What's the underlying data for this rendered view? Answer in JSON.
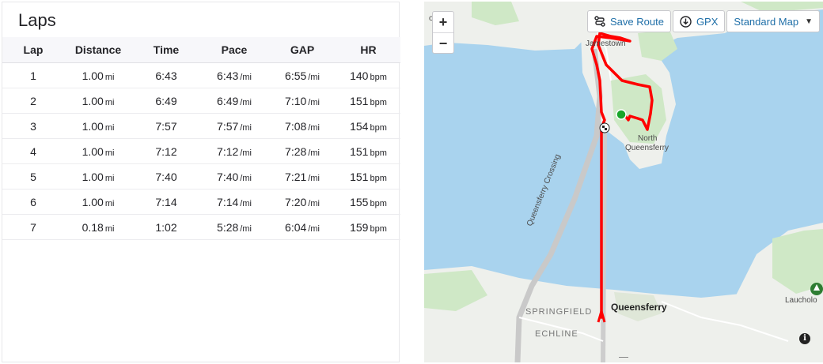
{
  "laps_panel": {
    "title": "Laps",
    "columns": [
      "Lap",
      "Distance",
      "Time",
      "Pace",
      "GAP",
      "HR"
    ],
    "rows": [
      {
        "lap": "1",
        "distance": "1.00",
        "distance_unit": "mi",
        "time": "6:43",
        "pace": "6:43",
        "pace_unit": "/mi",
        "gap": "6:55",
        "gap_unit": "/mi",
        "hr": "140",
        "hr_unit": "bpm"
      },
      {
        "lap": "2",
        "distance": "1.00",
        "distance_unit": "mi",
        "time": "6:49",
        "pace": "6:49",
        "pace_unit": "/mi",
        "gap": "7:10",
        "gap_unit": "/mi",
        "hr": "151",
        "hr_unit": "bpm"
      },
      {
        "lap": "3",
        "distance": "1.00",
        "distance_unit": "mi",
        "time": "7:57",
        "pace": "7:57",
        "pace_unit": "/mi",
        "gap": "7:08",
        "gap_unit": "/mi",
        "hr": "154",
        "hr_unit": "bpm"
      },
      {
        "lap": "4",
        "distance": "1.00",
        "distance_unit": "mi",
        "time": "7:12",
        "pace": "7:12",
        "pace_unit": "/mi",
        "gap": "7:28",
        "gap_unit": "/mi",
        "hr": "151",
        "hr_unit": "bpm"
      },
      {
        "lap": "5",
        "distance": "1.00",
        "distance_unit": "mi",
        "time": "7:40",
        "pace": "7:40",
        "pace_unit": "/mi",
        "gap": "7:21",
        "gap_unit": "/mi",
        "hr": "151",
        "hr_unit": "bpm"
      },
      {
        "lap": "6",
        "distance": "1.00",
        "distance_unit": "mi",
        "time": "7:14",
        "pace": "7:14",
        "pace_unit": "/mi",
        "gap": "7:20",
        "gap_unit": "/mi",
        "hr": "155",
        "hr_unit": "bpm"
      },
      {
        "lap": "7",
        "distance": "0.18",
        "distance_unit": "mi",
        "time": "1:02",
        "pace": "5:28",
        "pace_unit": "/mi",
        "gap": "6:04",
        "gap_unit": "/mi",
        "hr": "159",
        "hr_unit": "bpm"
      }
    ]
  },
  "map": {
    "zoom_in_label": "+",
    "zoom_out_label": "−",
    "toolbar": {
      "save_route_label": "Save Route",
      "save_route_icon": "route-icon",
      "gpx_label": "GPX",
      "gpx_icon": "download-icon",
      "map_style_label": "Standard Map",
      "map_style_icon": "caret-down-icon"
    },
    "labels": {
      "jamestown": "Jamestown",
      "north_queensferry_1": "North",
      "north_queensferry_2": "Queensferry",
      "queensferry_crossing": "Queensferry Crossing",
      "queensferry": "Queensferry",
      "springfield": "SPRINGFIELD",
      "echline": "ECHLINE",
      "lauchold": "Laucholo",
      "road_top": "ord"
    },
    "info_label": "i",
    "colors": {
      "water": "#a9d3ee",
      "land": "#eef0ec",
      "park": "#cfe8c6",
      "route": "#ff0000",
      "start_marker": "#1aa62b"
    }
  }
}
